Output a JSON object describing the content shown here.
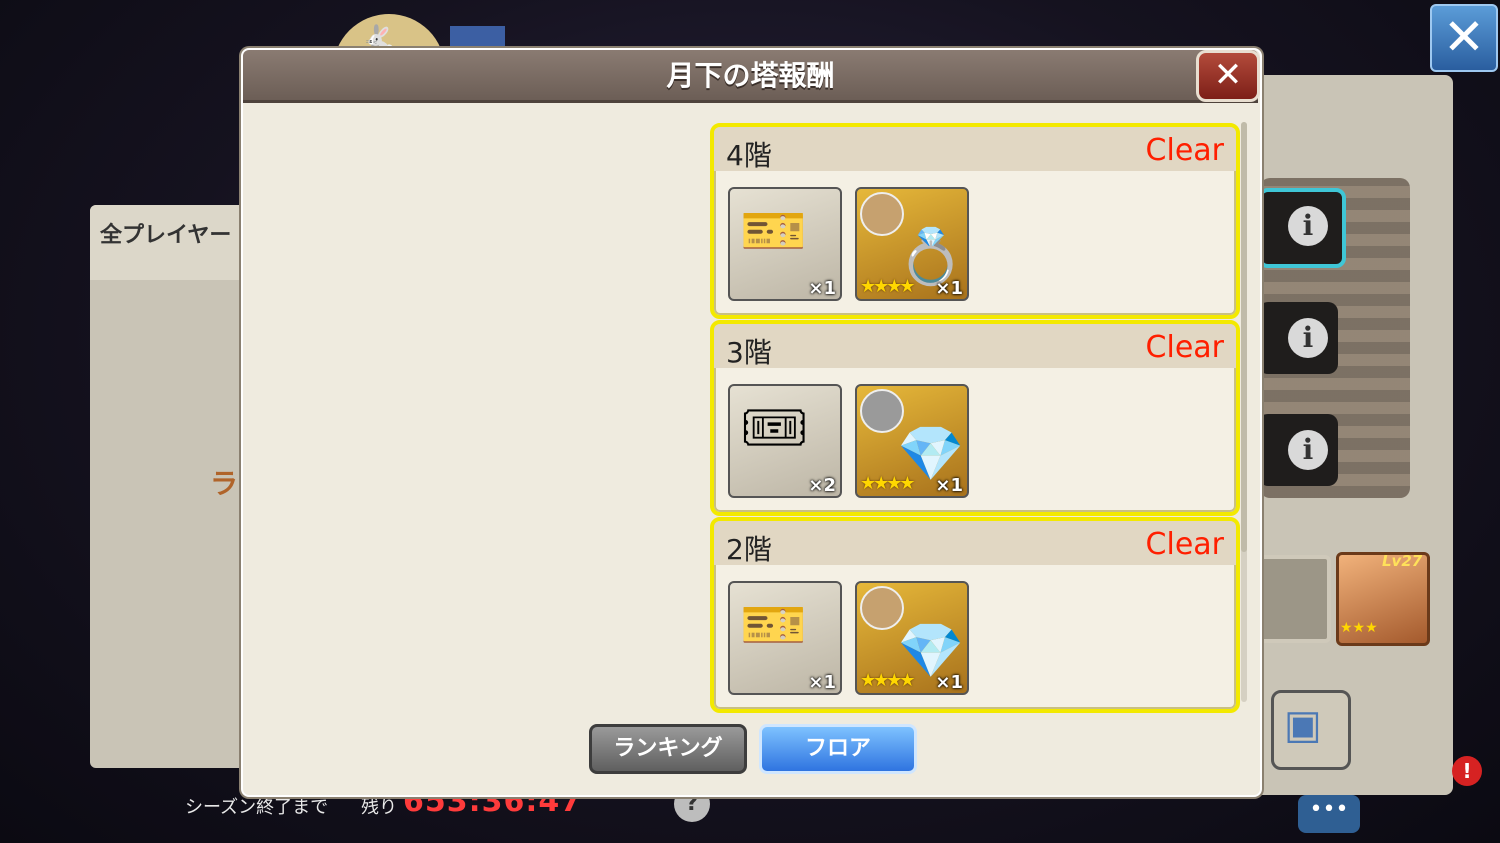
{
  "background": {
    "left_panel_title": "全プレイヤー",
    "left_panel_fragment": "ラ",
    "info_button_label": "i",
    "level_badge": "Lv27",
    "level_stars": "★★★",
    "season_end_label": "シーズン終了まで",
    "remaining_label": "残り",
    "timer": "653:36:47",
    "help_label": "?",
    "alert_label": "!",
    "chat_label": "•••"
  },
  "top_close_label": "✕",
  "modal": {
    "title": "月下の塔報酬",
    "close_label": "✕"
  },
  "floors": [
    {
      "name": "4階",
      "status": "Clear",
      "items": [
        {
          "icon": "ticket-icon",
          "art": "🎫",
          "count": "×1"
        },
        {
          "icon": "bracelet-icon",
          "art": "💍",
          "stars": "★★★★",
          "count": "×1"
        }
      ]
    },
    {
      "name": "3階",
      "status": "Clear",
      "items": [
        {
          "icon": "blue-ticket-icon",
          "art": "🎟",
          "count": "×2"
        },
        {
          "icon": "earring-icon",
          "art": "💎",
          "stars": "★★★★",
          "count": "×1"
        }
      ]
    },
    {
      "name": "2階",
      "status": "Clear",
      "items": [
        {
          "icon": "ticket-icon",
          "art": "🎫",
          "count": "×1"
        },
        {
          "icon": "earring-icon",
          "art": "💎",
          "stars": "★★★★",
          "count": "×1"
        }
      ]
    }
  ],
  "buttons": {
    "ranking": "ランキング",
    "floor": "フロア"
  },
  "colors": {
    "clear_text": "#ff1f00",
    "highlight_border": "#f3e900",
    "active_button": "#2f74e0"
  }
}
